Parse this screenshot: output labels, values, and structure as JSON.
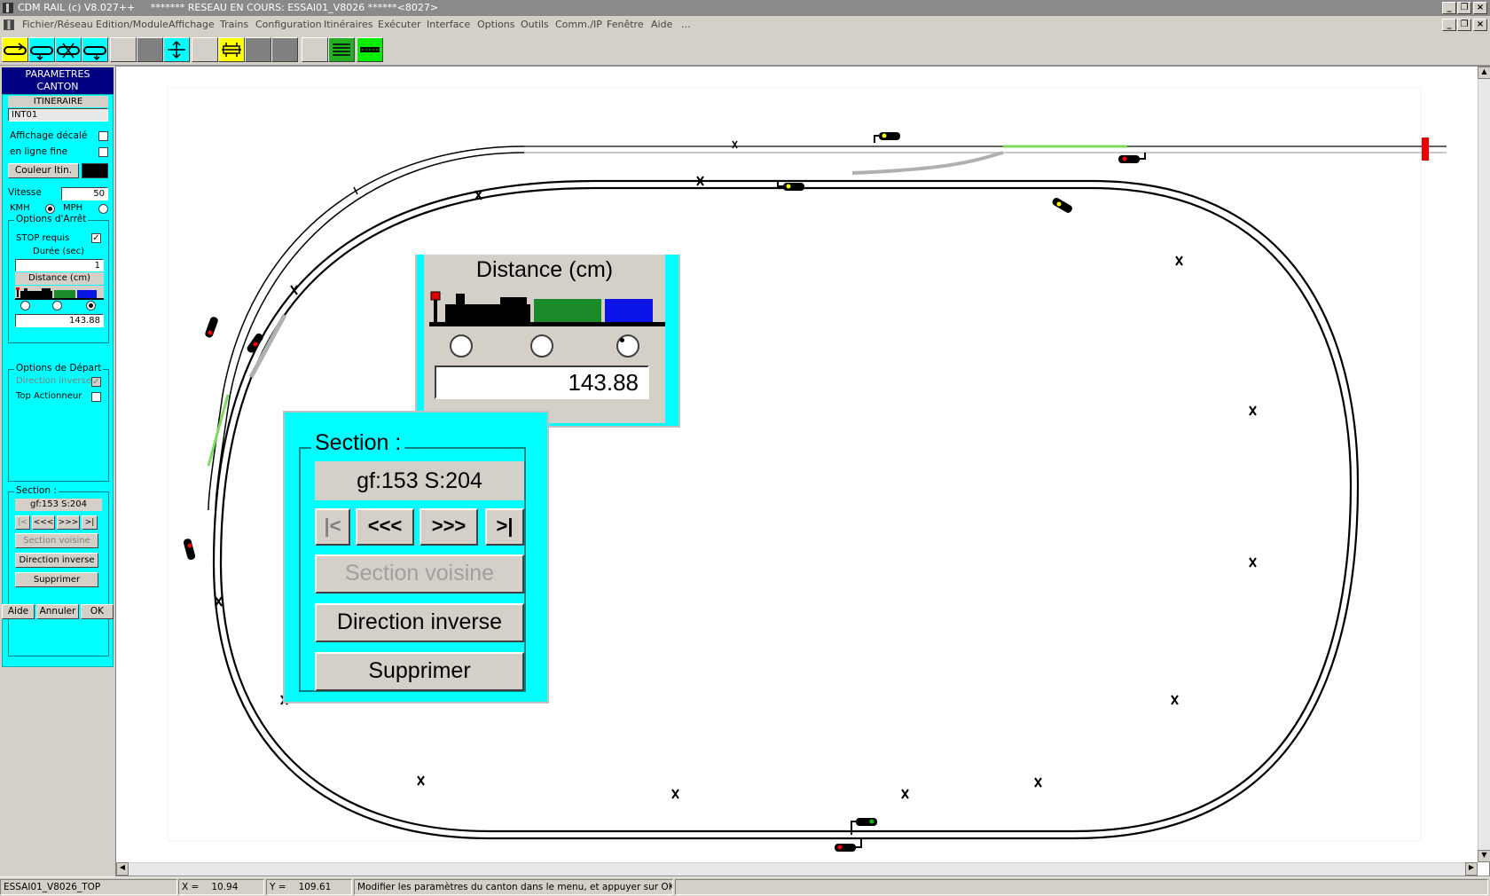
{
  "window": {
    "app_title": "CDM RAIL (c) V8.027++",
    "network_title": "******* RESEAU EN COURS: ESSAI01_V8026 ******<8027>"
  },
  "menu": [
    "Fichier/Réseau",
    "Edition/Module",
    "Affichage",
    "Trains",
    "Configuration",
    "Itinéraires",
    "Exécuter",
    "Interface",
    "Options",
    "Outils",
    "Comm./IP",
    "Fenêtre",
    "Aide",
    "..."
  ],
  "toolbar": {
    "icons": [
      "loop-yellow-icon",
      "loop-arrow-icon",
      "loop-cross-icon",
      "loop-arrow2-icon",
      "blank-icon",
      "gray-square-icon",
      "track-cross-cyan-icon",
      "blank2-icon",
      "train-yellow-icon",
      "gray-square2-icon",
      "gray-square3-icon",
      "blank3-icon",
      "green-lines-icon",
      "green-bar-icon"
    ]
  },
  "panel": {
    "header": "PARAMETRES\nCANTON",
    "itineraire_label": "ITINERAIRE",
    "itineraire_value": "INT01",
    "affichage_decale": "Affichage décalé",
    "ligne_fine": "en ligne fine",
    "couleur_itin": "Couleur Itin.",
    "vitesse_label": "Vitesse",
    "vitesse_value": "50",
    "kmh": "KMH",
    "mph": "MPH",
    "options_arret": "Options d'Arrêt",
    "stop_requis": "STOP requis",
    "stop_checked": "✓",
    "duree": "Durée (sec)",
    "duree_value": "1",
    "distance": "Distance (cm)",
    "distance_value": "143.88",
    "options_depart": "Options de Départ",
    "direction_inverse_chk": "Direction inverse",
    "direction_inverse_mark": "✓",
    "top_actionneur": "Top Actionneur",
    "section_label": "Section :",
    "section_value": "gf:153 S:204",
    "nav": [
      "|<",
      "<<<",
      ">>>",
      ">|"
    ],
    "section_voisine": "Section voisine",
    "direction_inverse_btn": "Direction inverse",
    "supprimer": "Supprimer",
    "aide": "Aide",
    "annuler": "Annuler",
    "ok": "OK"
  },
  "colors": {
    "cyan": "#00ffff",
    "header_blue": "#000080",
    "track": "#000000",
    "buffer_red": "#ee0000",
    "route_green": "#7cdc5c"
  },
  "status": {
    "file": "ESSAI01_V8026_TOP",
    "x_label": "X =",
    "x_value": "10.94",
    "y_label": "Y =",
    "y_value": "109.61",
    "message": "Modifier les paramètres du canton dans le menu, et appuyer sur OK"
  }
}
